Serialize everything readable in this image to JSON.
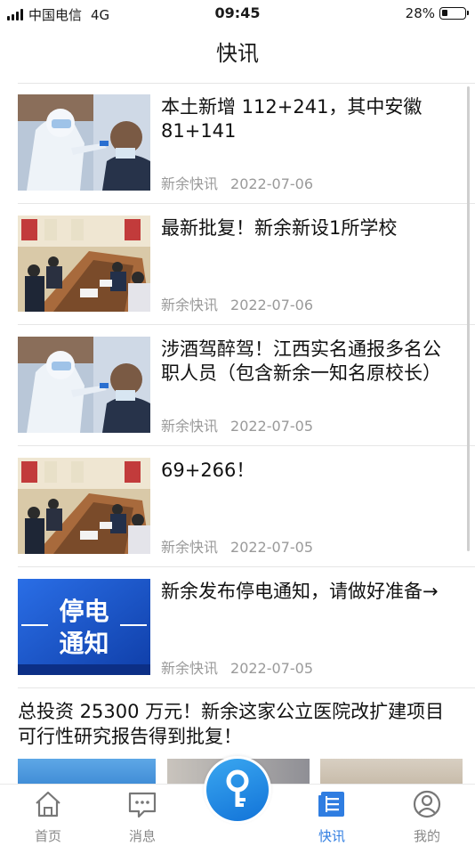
{
  "status_bar": {
    "carrier": "中国电信",
    "network": "4G",
    "time": "09:45",
    "battery": "28%",
    "battery_level": 0.28
  },
  "header": {
    "title": "快讯"
  },
  "news": [
    {
      "title": "本土新增 112+241，其中安徽 81+141",
      "source": "新余快讯",
      "date": "2022-07-06",
      "thumb": "medical-swab-photo"
    },
    {
      "title": "最新批复！新余新设1所学校",
      "source": "新余快讯",
      "date": "2022-07-06",
      "thumb": "meeting-room-photo"
    },
    {
      "title": "涉酒驾醉驾！江西实名通报多名公职人员（包含新余一知名原校长）",
      "source": "新余快讯",
      "date": "2022-07-05",
      "thumb": "medical-swab-photo"
    },
    {
      "title": "69+266！",
      "source": "新余快讯",
      "date": "2022-07-05",
      "thumb": "meeting-room-photo"
    },
    {
      "title": "新余发布停电通知，请做好准备→",
      "source": "新余快讯",
      "date": "2022-07-05",
      "thumb": "power-outage-notice-graphic",
      "thumb_text": [
        "停电",
        "通知"
      ]
    }
  ],
  "featured": {
    "title": "总投资 25300 万元！新余这家公立医院改扩建项目可行性研究报告得到批复！"
  },
  "tabs": [
    {
      "label": "首页",
      "icon": "home-icon"
    },
    {
      "label": "消息",
      "icon": "message-icon"
    },
    {
      "label": "快讯",
      "icon": "news-icon",
      "active": true
    },
    {
      "label": "我的",
      "icon": "profile-icon"
    }
  ],
  "center_button": {
    "icon": "key-icon"
  },
  "colors": {
    "accent": "#2f7de1",
    "meta_gray": "#9a9a9a",
    "notice_blue": "#1b56c7"
  }
}
